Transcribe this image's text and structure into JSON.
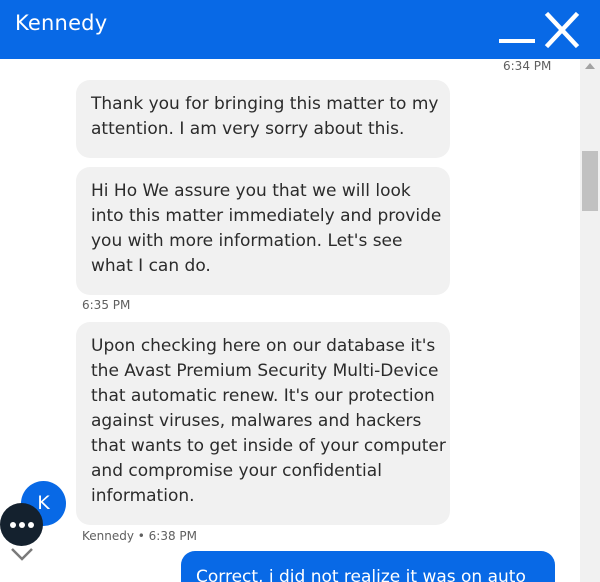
{
  "header": {
    "title": "Kennedy",
    "minimize_icon": "minimize-icon",
    "close_icon": "close-icon"
  },
  "messages": {
    "ts_top": "6:34 PM",
    "bubble1": {
      "lines": [
        "Thank you for bringing this matter to my",
        "attention. I am very sorry about this."
      ]
    },
    "bubble2": {
      "lines": [
        "Hi Ho We assure you that we will look",
        "into this matter immediately and provide",
        "you with more information.   Let's see",
        "what I can do."
      ]
    },
    "ts_mid": "6:35 PM",
    "bubble3": {
      "lines": [
        "Upon checking here on our database it's",
        "the Avast Premium Security Multi-Device",
        "that automatic renew. It's our protection",
        "against viruses, malwares and hackers",
        "that wants to get inside of your computer",
        "and compromise your confidential",
        "information."
      ]
    },
    "ts_bottom": "Kennedy • 6:38 PM",
    "user_bubble": {
      "lines": [
        "Correct, i did not realize it was on auto"
      ]
    }
  },
  "agent": {
    "avatar_letter": "K"
  },
  "controls": {
    "more_icon": "more-options-icon",
    "chevron_icon": "chevron-down-icon"
  },
  "colors": {
    "accent": "#0869e6",
    "bubble": "#f1f1f1",
    "more_button": "#14212e"
  }
}
